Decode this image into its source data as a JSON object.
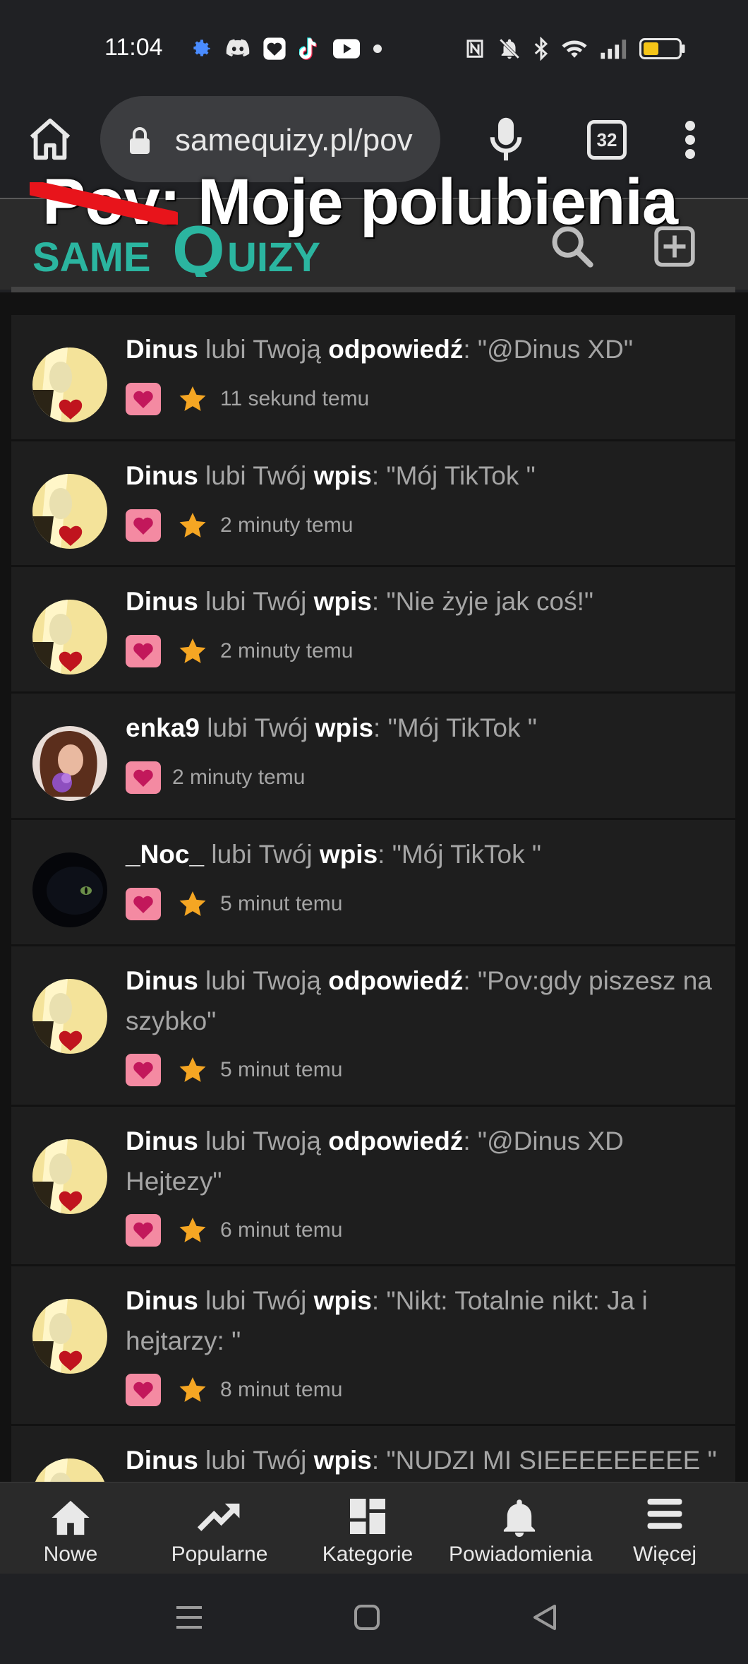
{
  "status_bar": {
    "time": "11:04"
  },
  "browser": {
    "url": "samequizy.pl/pov",
    "tab_count": "32"
  },
  "site": {
    "overlay_title": "Pov: Moje polubienia",
    "logo_text_left": "SAME",
    "logo_text_q": "Q",
    "logo_text_right": "UIZY"
  },
  "notifications": [
    {
      "user": "Dinus",
      "verb": " lubi ",
      "possessive": "Twoją ",
      "target": "odpowiedź",
      "quote": ": \"@Dinus XD\"",
      "time": "11 sekund temu",
      "starred": true
    },
    {
      "user": "Dinus",
      "verb": " lubi ",
      "possessive": "Twój ",
      "target": "wpis",
      "quote": ": \"Mój TikTok \"",
      "time": "2 minuty temu",
      "starred": true
    },
    {
      "user": "Dinus",
      "verb": " lubi ",
      "possessive": "Twój ",
      "target": "wpis",
      "quote": ": \"Nie żyje jak coś!\"",
      "time": "2 minuty temu",
      "starred": true
    },
    {
      "user": "enka9",
      "verb": " lubi ",
      "possessive": "Twój ",
      "target": "wpis",
      "quote": ": \"Mój TikTok \"",
      "time": "2 minuty temu",
      "starred": false
    },
    {
      "user": "_Noc_",
      "verb": " lubi ",
      "possessive": "Twój ",
      "target": "wpis",
      "quote": ": \"Mój TikTok \"",
      "time": "5 minut temu",
      "starred": true
    },
    {
      "user": "Dinus",
      "verb": " lubi ",
      "possessive": "Twoją ",
      "target": "odpowiedź",
      "quote": ": \"Pov:gdy piszesz na szybko\"",
      "time": "5 minut temu",
      "starred": true
    },
    {
      "user": "Dinus",
      "verb": " lubi ",
      "possessive": "Twoją ",
      "target": "odpowiedź",
      "quote": ": \"@Dinus XD Hejtezy\"",
      "time": "6 minut temu",
      "starred": true
    },
    {
      "user": "Dinus",
      "verb": " lubi ",
      "possessive": "Twój ",
      "target": "wpis",
      "quote": ": \"Nikt: Totalnie nikt: Ja i hejtarzy: \"",
      "time": "8 minut temu",
      "starred": true
    },
    {
      "user": "Dinus",
      "verb": " lubi ",
      "possessive": "Twój ",
      "target": "wpis",
      "quote": ": \"NUDZI MI SIEEEEEEEEE \"",
      "time": "",
      "starred": false
    }
  ],
  "bottom_nav": [
    {
      "label": "Nowe",
      "icon": "home-icon"
    },
    {
      "label": "Popularne",
      "icon": "trending-icon"
    },
    {
      "label": "Kategorie",
      "icon": "dashboard-icon"
    },
    {
      "label": "Powiadomienia",
      "icon": "bell-icon"
    },
    {
      "label": "Więcej",
      "icon": "menu-icon"
    }
  ],
  "colors": {
    "accent": "#2bb5a0",
    "heart_bg": "#f48aa2",
    "heart": "#c2185b",
    "star": "#f5a623"
  }
}
